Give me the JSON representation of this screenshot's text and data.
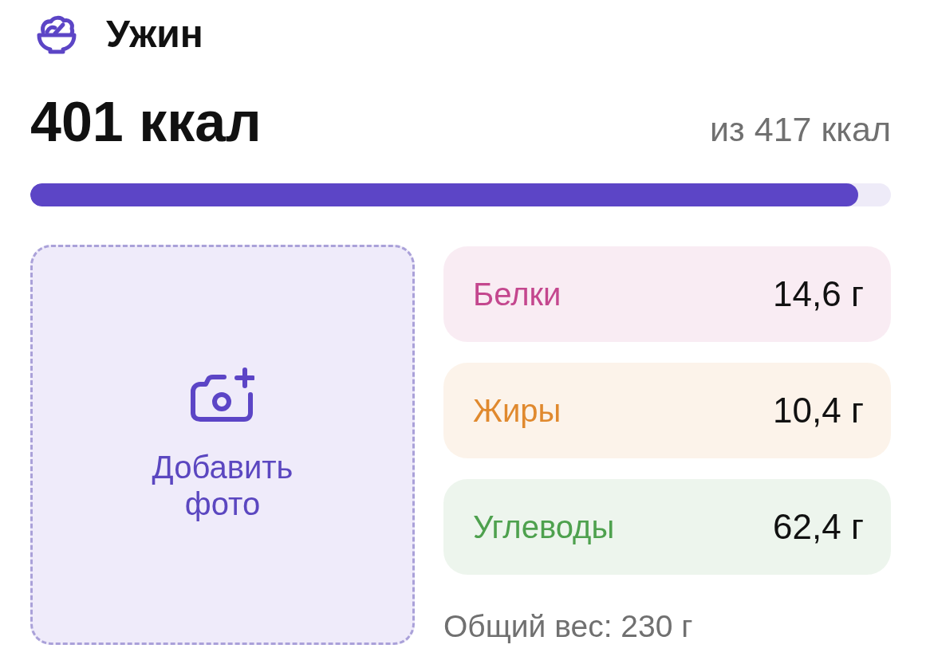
{
  "meal": {
    "title": "Ужин"
  },
  "calories": {
    "eaten": "401 ккал",
    "goal": "из 417 ккал",
    "level": 0.962
  },
  "photo": {
    "label": "Добавить фото"
  },
  "macros": [
    {
      "name": "Белки",
      "value": "14,6 г",
      "color": "#c4478e"
    },
    {
      "name": "Жиры",
      "value": "10,4 г",
      "color": "#e0892e"
    },
    {
      "name": "Углеводы",
      "value": "62,4 г",
      "color": "#4ea14e"
    }
  ],
  "total_weight": "Общий вес: 230 г"
}
